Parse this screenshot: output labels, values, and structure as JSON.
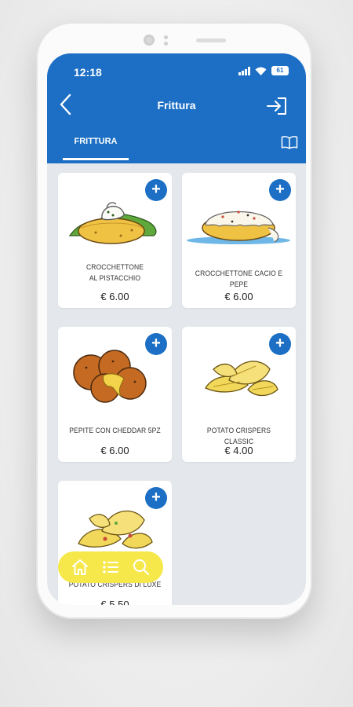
{
  "status_bar": {
    "time": "12:18",
    "battery": "61"
  },
  "header": {
    "title": "Frittura"
  },
  "tabs": [
    {
      "label": "FRITTURA"
    }
  ],
  "products": [
    {
      "name": "CROCCHETTONE\nAL PISTACCHIO",
      "price": "€ 6.00"
    },
    {
      "name": "CROCCHETTONE CACIO E PEPE",
      "price": "€ 6.00"
    },
    {
      "name": "PEPITE CON CHEDDAR 5PZ",
      "price": "€ 6.00"
    },
    {
      "name": "POTATO CRISPERS CLASSIC",
      "price": "€ 4.00"
    },
    {
      "name": "POTATO CRISPERS DI LUXE",
      "price": "€ 5.50"
    }
  ],
  "icons": {
    "back": "chevron-left-icon",
    "exit": "login-icon",
    "menu": "book-icon",
    "add": "plus-icon",
    "nav_home": "home-icon",
    "nav_list": "list-icon",
    "nav_search": "search-icon"
  },
  "colors": {
    "primary": "#1c6fc4",
    "nav": "#f6e84a",
    "background": "#e4e8ec"
  }
}
